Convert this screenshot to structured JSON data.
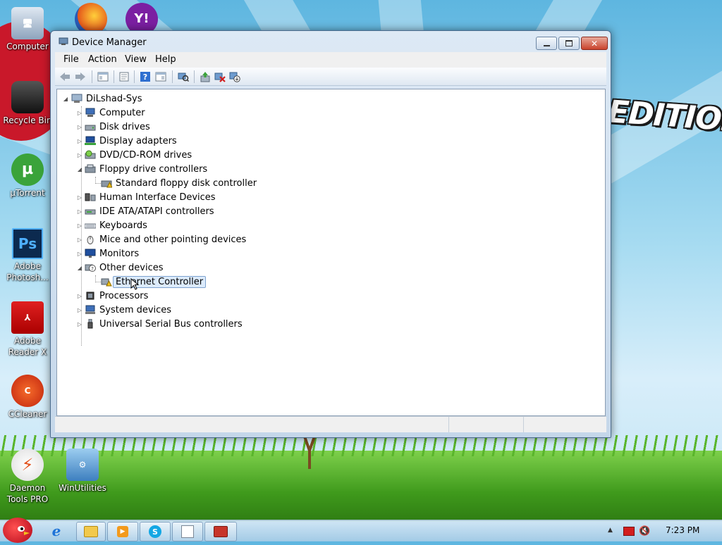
{
  "desktop": {
    "icons": [
      {
        "label": "Computer"
      },
      {
        "label": "Recycle Bin"
      },
      {
        "label": "µTorrent"
      },
      {
        "label": "Adobe Photosh..."
      },
      {
        "label": "Adobe Reader X"
      },
      {
        "label": "CCleaner"
      },
      {
        "label": "Daemon Tools PRO"
      },
      {
        "label": "WinUtilities"
      }
    ],
    "wallpaper_text": "EDITION"
  },
  "window": {
    "title": "Device Manager",
    "menu": [
      "File",
      "Action",
      "View",
      "Help"
    ],
    "tree": {
      "root": "DiLshad-Sys",
      "items": [
        {
          "label": "Computer",
          "icon": "computer-icon",
          "expanded": false
        },
        {
          "label": "Disk drives",
          "icon": "disk-drive-icon",
          "expanded": false
        },
        {
          "label": "Display adapters",
          "icon": "display-adapter-icon",
          "expanded": false
        },
        {
          "label": "DVD/CD-ROM drives",
          "icon": "dvd-drive-icon",
          "expanded": false
        },
        {
          "label": "Floppy drive controllers",
          "icon": "floppy-controller-icon",
          "expanded": true
        },
        {
          "label": "Standard floppy disk controller",
          "icon": "warning-device-icon",
          "child": true
        },
        {
          "label": "Human Interface Devices",
          "icon": "hid-icon",
          "expanded": false
        },
        {
          "label": "IDE ATA/ATAPI controllers",
          "icon": "ide-controller-icon",
          "expanded": false
        },
        {
          "label": "Keyboards",
          "icon": "keyboard-icon",
          "expanded": false
        },
        {
          "label": "Mice and other pointing devices",
          "icon": "mouse-icon",
          "expanded": false
        },
        {
          "label": "Monitors",
          "icon": "monitor-icon",
          "expanded": false
        },
        {
          "label": "Other devices",
          "icon": "unknown-device-icon",
          "expanded": true
        },
        {
          "label": "Ethernet Controller",
          "icon": "warning-device-icon",
          "child": true,
          "selected": true
        },
        {
          "label": "Processors",
          "icon": "processor-icon",
          "expanded": false
        },
        {
          "label": "System devices",
          "icon": "system-device-icon",
          "expanded": false
        },
        {
          "label": "Universal Serial Bus controllers",
          "icon": "usb-icon",
          "expanded": false
        }
      ]
    }
  },
  "taskbar": {
    "clock": "7:23 PM"
  },
  "colors": {
    "selection_border": "#7da2ce",
    "selection_fill": "#dcebfc",
    "warning": "#f2c21b"
  }
}
